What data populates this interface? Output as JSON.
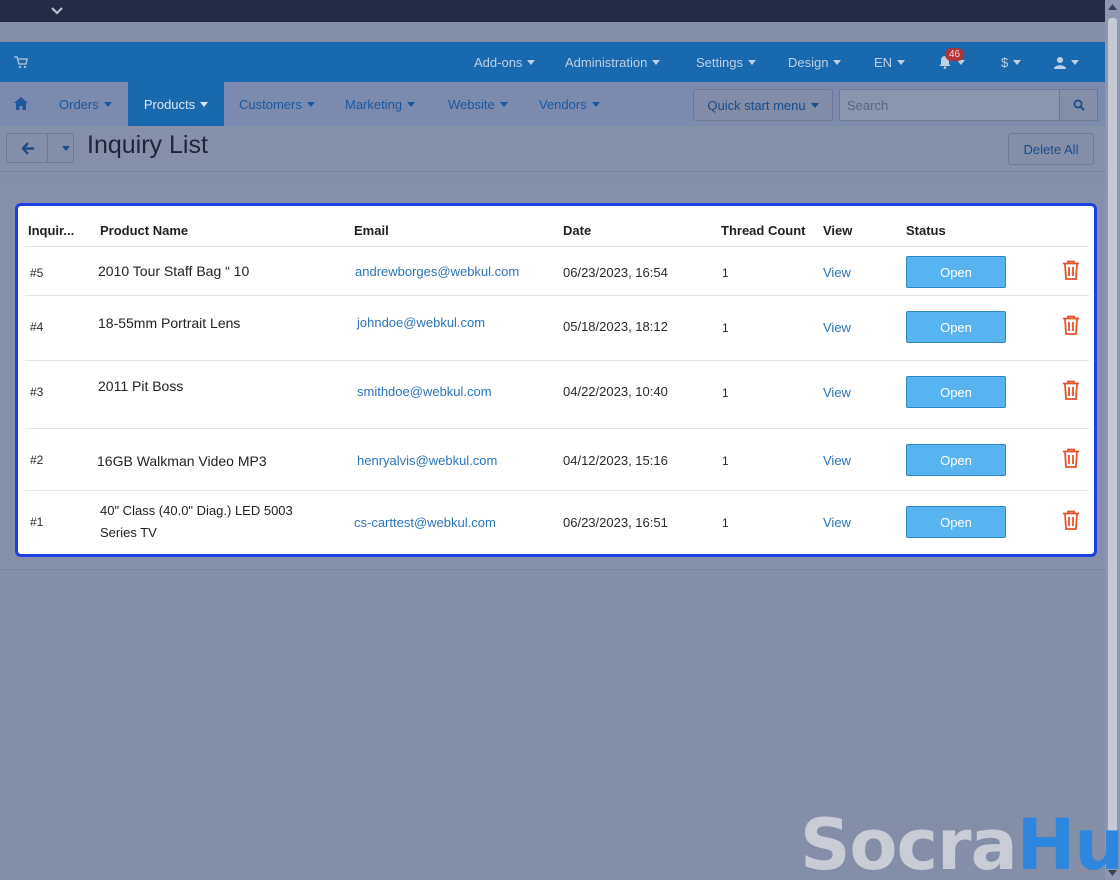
{
  "topbar": {
    "menus": [
      {
        "label": "Add-ons",
        "name": "addons"
      },
      {
        "label": "Administration",
        "name": "administration"
      },
      {
        "label": "Settings",
        "name": "settings"
      },
      {
        "label": "Design",
        "name": "design"
      },
      {
        "label": "EN",
        "name": "language"
      }
    ],
    "notifications_count": "46",
    "currency": "$"
  },
  "nav": {
    "items": [
      "Orders",
      "Products",
      "Customers",
      "Marketing",
      "Website",
      "Vendors"
    ],
    "active": "Products",
    "quick_start": "Quick start menu",
    "search_placeholder": "Search"
  },
  "page": {
    "title": "Inquiry List",
    "delete_all": "Delete All"
  },
  "table": {
    "headers": [
      "Inquir...",
      "Product Name",
      "Email",
      "Date",
      "Thread Count",
      "View",
      "Status"
    ],
    "rows": [
      {
        "id": "#5",
        "product": "2010 Tour Staff Bag “ 10",
        "email": "andrewborges@webkul.com",
        "date": "06/23/2023, 16:54",
        "threads": "1",
        "view": "View",
        "status": "Open"
      },
      {
        "id": "#4",
        "product": "18-55mm Portrait Lens",
        "email": "johndoe@webkul.com",
        "date": "05/18/2023, 18:12",
        "threads": "1",
        "view": "View",
        "status": "Open"
      },
      {
        "id": "#3",
        "product": "2011 Pit Boss",
        "email": "smithdoe@webkul.com",
        "date": "04/22/2023, 10:40",
        "threads": "1",
        "view": "View",
        "status": "Open"
      },
      {
        "id": "#2",
        "product": "16GB Walkman Video MP3",
        "email": "henryalvis@webkul.com",
        "date": "04/12/2023, 15:16",
        "threads": "1",
        "view": "View",
        "status": "Open"
      },
      {
        "id": "#1",
        "product": "40\" Class (40.0\" Diag.) LED 5003 Series TV",
        "email": "cs-carttest@webkul.com",
        "date": "06/23/2023, 16:51",
        "threads": "1",
        "view": "View",
        "status": "Open"
      }
    ]
  },
  "watermark": {
    "part1": "Socra",
    "part2": "Hub"
  },
  "colors": {
    "brand_blue": "#1a68ad",
    "open_button": "#58b4ee",
    "trash": "#e8542a",
    "highlight_border": "#1f3fe6"
  }
}
